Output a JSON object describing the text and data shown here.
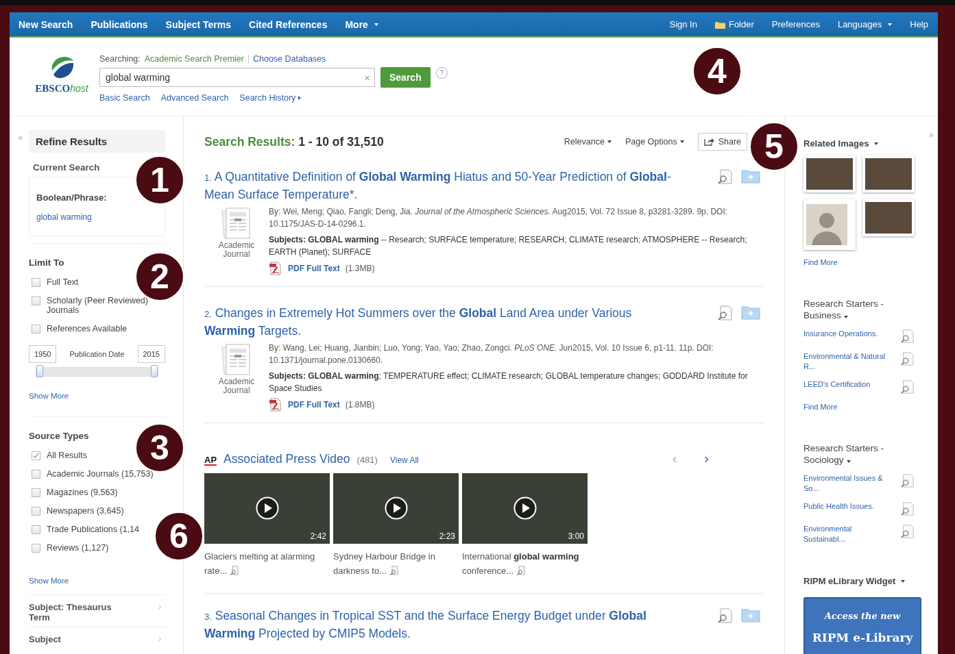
{
  "nav": {
    "left": [
      {
        "label": "New Search",
        "kind": "link"
      },
      {
        "label": "Publications",
        "kind": "link"
      },
      {
        "label": "Subject Terms",
        "kind": "link"
      },
      {
        "label": "Cited References",
        "kind": "link"
      },
      {
        "label": "More",
        "kind": "dropdown"
      }
    ],
    "right": [
      {
        "label": "Sign In",
        "kind": "link"
      },
      {
        "label": "Folder",
        "kind": "folder"
      },
      {
        "label": "Preferences",
        "kind": "link"
      },
      {
        "label": "Languages",
        "kind": "dropdown"
      },
      {
        "label": "Help",
        "kind": "link"
      }
    ]
  },
  "header": {
    "logo": {
      "brand": "EBSCO",
      "suffix": "host"
    },
    "searching_label": "Searching:",
    "database": "Academic Search Premier",
    "choose_link": "Choose Databases",
    "query": "global warming",
    "clear": "×",
    "button": "Search",
    "help": "?",
    "links": [
      {
        "label": "Basic Search",
        "kind": "link"
      },
      {
        "label": "Advanced Search",
        "kind": "link"
      },
      {
        "label": "Search History",
        "kind": "expand"
      }
    ]
  },
  "sidebar": {
    "collapse": "«",
    "title": "Refine Results",
    "current_search": {
      "title": "Current Search",
      "label": "Boolean/Phrase:",
      "value": "global warming"
    },
    "limit_to": {
      "title": "Limit To",
      "options": [
        {
          "label": "Full Text",
          "checked": false
        },
        {
          "label": "Scholarly (Peer Reviewed) Journals",
          "checked": false
        },
        {
          "label": "References Available",
          "checked": false
        }
      ],
      "date": {
        "from": "1950",
        "label": "Publication Date",
        "to": "2015",
        "thumbs": [
          {
            "level": 0
          },
          {
            "level": 1
          }
        ]
      },
      "show_more": "Show More"
    },
    "source_types": {
      "title": "Source Types",
      "options": [
        {
          "label": "All Results",
          "checked": true
        },
        {
          "label": "Academic Journals (15,753)",
          "checked": false
        },
        {
          "label": "Magazines (9,563)",
          "checked": false
        },
        {
          "label": "Newspapers (3,645)",
          "checked": false
        },
        {
          "label": "Trade Publications (1,14",
          "checked": false
        },
        {
          "label": "Reviews (1,127)",
          "checked": false
        }
      ],
      "show_more": "Show More"
    },
    "facets": [
      {
        "label": "Subject: Thesaurus Term",
        "arrow": "›"
      },
      {
        "label": "Subject",
        "arrow": "›"
      }
    ]
  },
  "results": {
    "label": "Search Results:",
    "range": "1 - 10 of 31,510",
    "sort": "Relevance",
    "page_options": "Page Options",
    "share": "Share",
    "items": [
      {
        "number": "1.",
        "title": "A Quantitative Definition of **Global Warming** Hiatus and 50-Year Prediction of **Global**-Mean Surface Temperature*.",
        "byline": "By: Wei, Meng; Qiao, Fangli; Deng, Jia. *Journal of the Atmospheric Sciences.* Aug2015, Vol. 72 Issue 8, p3281-3289. 9p. DOI: 10.1175/JAS-D-14-0296.1.",
        "subjects": "**Subjects: GLOBAL warming** -- Research; SURFACE temperature; RESEARCH; CLIMATE research; ATMOSPHERE -- Research; EARTH (Planet); SURFACE",
        "type": "Academic Journal",
        "pdf": "PDF Full Text",
        "size": "(1.3MB)"
      },
      {
        "number": "2.",
        "title": "Changes in Extremely Hot Summers over the **Global** Land Area under Various **Warming** Targets.",
        "byline": "By: Wang, Lei; Huang, Jianbin; Luo, Yong; Yao, Yao; Zhao, Zongci. *PLoS ONE.* Jun2015, Vol. 10 Issue 6, p1-11. 11p. DOI: 10.1371/journal.pone.0130660.",
        "subjects": "**Subjects: GLOBAL warming**; TEMPERATURE effect; CLIMATE research; GLOBAL temperature changes; GODDARD Institute for Space Studies",
        "type": "Academic Journal",
        "pdf": "PDF Full Text",
        "size": "(1.8MB)"
      }
    ],
    "video": {
      "logo": "AP",
      "title": "Associated Press Video",
      "count": "(481)",
      "view_all": "View All",
      "prev": "‹",
      "next": "›",
      "items": [
        {
          "caption": "Glaciers melting at alarming rate...",
          "duration": "2:42"
        },
        {
          "caption": "Sydney Harbour Bridge in darkness to...",
          "duration": "2:23"
        },
        {
          "caption": "International **global warming** conference...",
          "duration": "3:00"
        }
      ]
    },
    "more_items": [
      {
        "number": "3.",
        "title": "Seasonal Changes in Tropical SST and the Surface Energy Budget under **Global Warming** Projected by CMIP5 Models."
      }
    ]
  },
  "right": {
    "expand": "»",
    "related_images": {
      "title": "Related Images",
      "images": [
        {
          "kind": "photo"
        },
        {
          "kind": "photo"
        },
        {
          "kind": "portrait"
        },
        {
          "kind": "photo"
        }
      ],
      "find_more": "Find More"
    },
    "starters": [
      {
        "title": "Research Starters - Business",
        "items": [
          "Insurance Operations.",
          "Environmental & Natural R...",
          "LEED's Certification"
        ],
        "find_more": "Find More"
      },
      {
        "title": "Research Starters - Sociology",
        "items": [
          "Environmental Issues & So...",
          "Public Health Issues.",
          "Environmental Sustainabl..."
        ]
      }
    ],
    "widget": {
      "title": "RIPM eLibrary Widget",
      "line1": "Access the new",
      "line2": "RIPM e-Library"
    }
  },
  "callouts": [
    {
      "label": "1"
    },
    {
      "label": "2"
    },
    {
      "label": "3"
    },
    {
      "label": "4"
    },
    {
      "label": "5"
    },
    {
      "label": "6"
    }
  ]
}
